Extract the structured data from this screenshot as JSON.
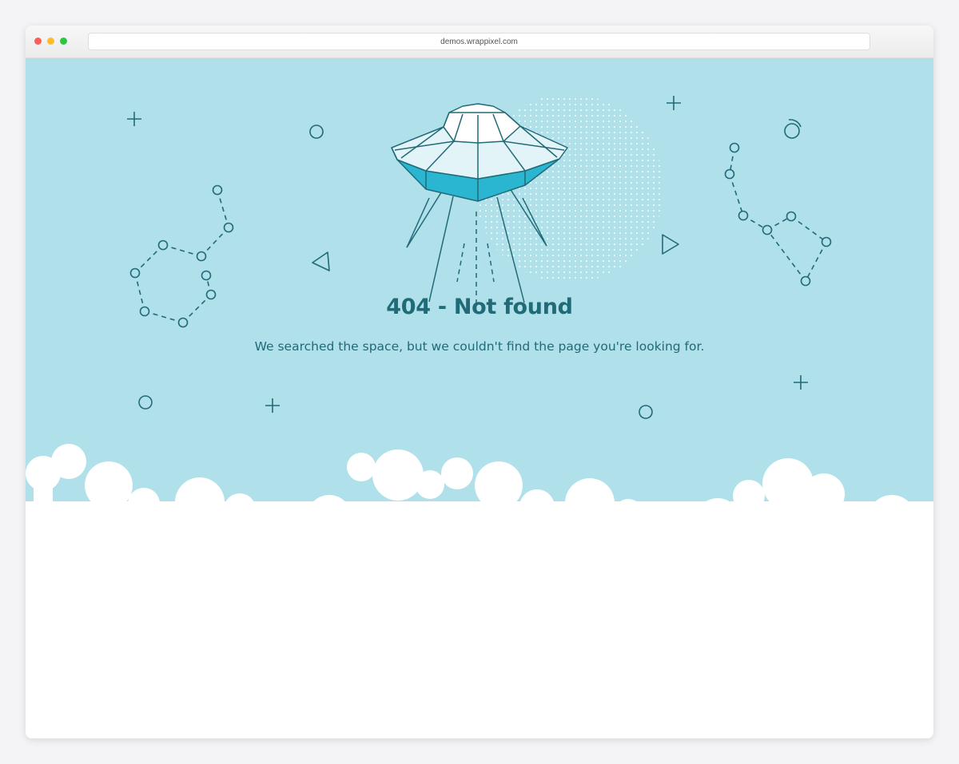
{
  "browser": {
    "url": "demos.wrappixel.com"
  },
  "page": {
    "title": "404 - Not found",
    "message": "We searched the space, but we couldn't find the page you're looking for."
  },
  "colors": {
    "sky": "#b0e0e9",
    "ink": "#216a77",
    "ufo_band": "#2ab6d0",
    "ufo_glass": "#e2f4f8",
    "cloud": "#ffffff"
  },
  "icons": [
    "ufo-icon",
    "constellation-icon",
    "plus-icon",
    "circle-icon",
    "triangle-icon",
    "planet-icon",
    "cloud-icon"
  ]
}
